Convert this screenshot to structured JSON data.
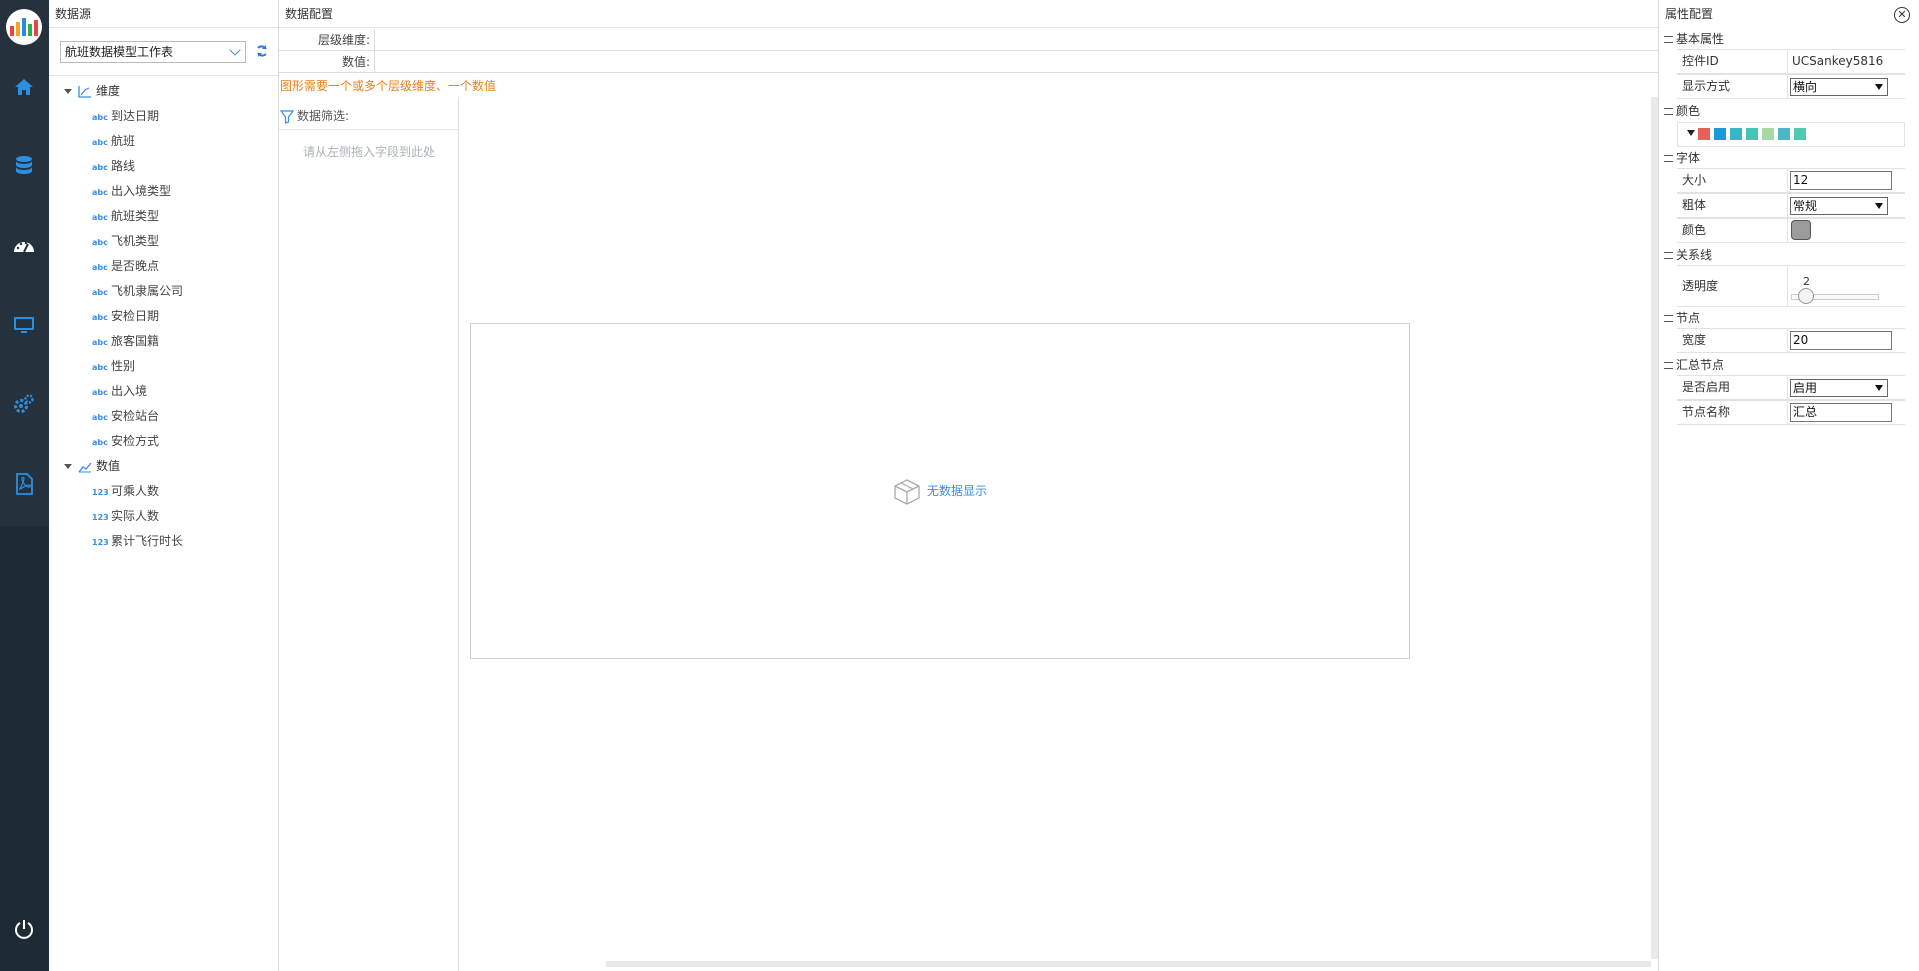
{
  "nav": {
    "icons": [
      "logo-icon",
      "home-icon",
      "database-icon",
      "dashboard-icon",
      "monitor-icon",
      "settings-icon",
      "pdf-icon",
      "power-icon"
    ],
    "logo_colors": [
      "#e8453c",
      "#f5a623",
      "#2e86de",
      "#27ae60"
    ]
  },
  "datasource": {
    "title": "数据源",
    "selected": "航班数据模型工作表",
    "dimension_group": "维度",
    "measure_group": "数值",
    "dimension_type": "abc",
    "measure_type": "123",
    "dimensions": [
      "到达日期",
      "航班",
      "路线",
      "出入境类型",
      "航班类型",
      "飞机类型",
      "是否晚点",
      "飞机隶属公司",
      "安检日期",
      "旅客国籍",
      "性别",
      "出入境",
      "安检站台",
      "安检方式"
    ],
    "measures": [
      "可乘人数",
      "实际人数",
      "累计飞行时长"
    ]
  },
  "dataconfig": {
    "title": "数据配置",
    "level_dimension_label": "层级维度:",
    "value_label": "数值:",
    "warning": "图形需要一个或多个层级维度、一个数值",
    "filter_label": "数据筛选:",
    "filter_hint": "请从左侧拖入字段到此处",
    "empty_text": "无数据显示"
  },
  "props": {
    "title": "属性配置",
    "basic_section": "基本属性",
    "control_id_label": "控件ID",
    "control_id_value": "UCSankey5816",
    "display_mode_label": "显示方式",
    "display_mode_value": "横向",
    "color_section": "颜色",
    "palette": [
      "#e8605c",
      "#1a9ad6",
      "#35b6c9",
      "#45c7b8",
      "#a6d9a0",
      "#4db6c8",
      "#52c9b0"
    ],
    "font_section": "字体",
    "size_label": "大小",
    "size_value": "12",
    "bold_label": "粗体",
    "bold_value": "常规",
    "font_color_label": "颜色",
    "link_section": "关系线",
    "opacity_label": "透明度",
    "opacity_value": "2",
    "node_section": "节点",
    "width_label": "宽度",
    "width_value": "20",
    "summary_section": "汇总节点",
    "enabled_label": "是否启用",
    "enabled_value": "启用",
    "node_name_label": "节点名称",
    "node_name_value": "汇总"
  }
}
